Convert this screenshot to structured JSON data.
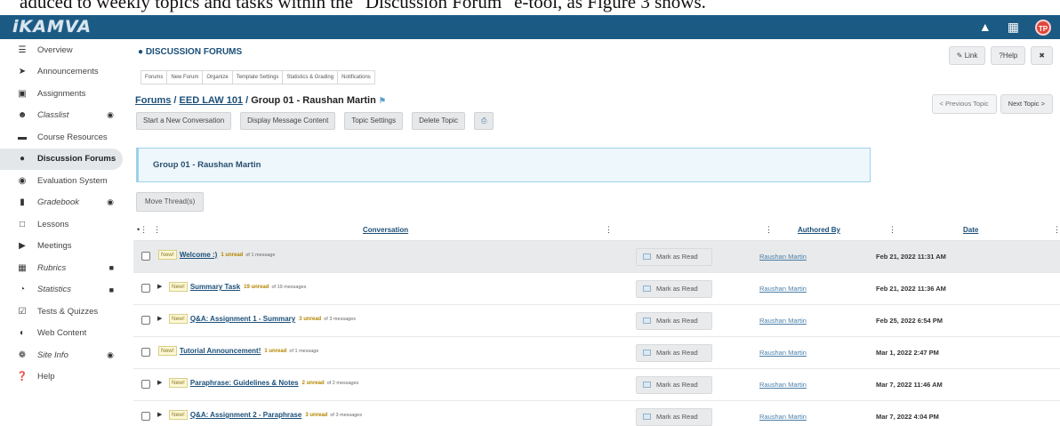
{
  "document_caption": "aduced to weekly topics and tasks within the \"Discussion Forum\" e-tool, as Figure 3 shows.",
  "app": {
    "logo_text": "iKAMVA",
    "avatar_initials": "TP"
  },
  "sidebar": {
    "items": [
      {
        "label": "Overview",
        "icon": "list-icon"
      },
      {
        "label": "Announcements",
        "icon": "megaphone-icon"
      },
      {
        "label": "Assignments",
        "icon": "assignment-icon"
      },
      {
        "label": "Classlist",
        "icon": "people-icon"
      },
      {
        "label": "Course Resources",
        "icon": "folder-icon"
      },
      {
        "label": "Discussion Forums",
        "icon": "chat-icon"
      },
      {
        "label": "Evaluation System",
        "icon": "speech-icon"
      },
      {
        "label": "Gradebook",
        "icon": "gradebook-icon"
      },
      {
        "label": "Lessons",
        "icon": "document-icon"
      },
      {
        "label": "Meetings",
        "icon": "video-icon"
      },
      {
        "label": "Rubrics",
        "icon": "table-icon"
      },
      {
        "label": "Statistics",
        "icon": "chart-icon"
      },
      {
        "label": "Tests & Quizzes",
        "icon": "checkbox-icon"
      },
      {
        "label": "Web Content",
        "icon": "globe-icon"
      },
      {
        "label": "Site Info",
        "icon": "gear-icon"
      },
      {
        "label": "Help",
        "icon": "help-icon"
      }
    ]
  },
  "header": {
    "title": "DISCUSSION FORUMS",
    "link_label": "Link",
    "help_label": "Help"
  },
  "tabs": [
    "Forums",
    "New Forum",
    "Organize",
    "Template Settings",
    "Statistics & Grading",
    "Notifications"
  ],
  "breadcrumb": {
    "forums": "Forums",
    "course": "EED LAW 101",
    "separator": "/",
    "current": "Group 01 - Raushan Martin"
  },
  "nav": {
    "previous": "< Previous Topic",
    "next": "Next Topic >"
  },
  "actions": {
    "start": "Start a New Conversation",
    "display": "Display Message Content",
    "settings": "Topic Settings",
    "delete": "Delete Topic"
  },
  "group_title": "Group 01 - Raushan Martin",
  "move_threads": "Move Thread(s)",
  "table": {
    "columns": {
      "conversation": "Conversation",
      "authored_by": "Authored By",
      "date": "Date"
    },
    "rows": [
      {
        "new": "New!",
        "title": "Welcome :)",
        "unread": "1 unread",
        "of": "of 1 message",
        "mark": "Mark as Read",
        "author": "Raushan Martin",
        "date": "Feb 21, 2022 11:31 AM"
      },
      {
        "new": "New!",
        "title": "Summary Task",
        "unread": "19 unread",
        "of": "of 19 messages",
        "mark": "Mark as Read",
        "author": "Raushan Martin",
        "date": "Feb 21, 2022 11:36 AM"
      },
      {
        "new": "New!",
        "title": "Q&A: Assignment 1 - Summary",
        "unread": "3 unread",
        "of": "of 3 messages",
        "mark": "Mark as Read",
        "author": "Raushan Martin",
        "date": "Feb 25, 2022 6:54 PM"
      },
      {
        "new": "New!",
        "title": "Tutorial Announcement!",
        "unread": "1 unread",
        "of": "of 1 message",
        "mark": "Mark as Read",
        "author": "Raushan Martin",
        "date": "Mar 1, 2022 2:47 PM"
      },
      {
        "new": "New!",
        "title": "Paraphrase: Guidelines & Notes",
        "unread": "2 unread",
        "of": "of 2 messages",
        "mark": "Mark as Read",
        "author": "Raushan Martin",
        "date": "Mar 7, 2022 11:46 AM"
      },
      {
        "new": "New!",
        "title": "Q&A: Assignment 2 - Paraphrase",
        "unread": "3 unread",
        "of": "of 3 messages",
        "mark": "Mark as Read",
        "author": "Raushan Martin",
        "date": "Mar 7, 2022 4:04 PM"
      }
    ]
  }
}
